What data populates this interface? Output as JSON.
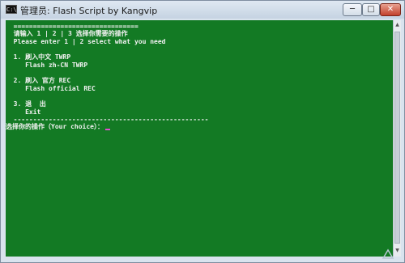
{
  "window": {
    "icon_text": "C:\\",
    "title": "管理员: Flash Script by Kangvip",
    "controls": {
      "minimize": "─",
      "maximize": "□",
      "close": "✕"
    }
  },
  "console": {
    "separator_top": "  ================================",
    "prompt_cn": "  请输入 1 | 2 | 3 选择你需要的操作",
    "prompt_en": "  Please enter 1 | 2 select what you need",
    "option1_cn": "  1. 刷入中文 TWRP",
    "option1_en": "     Flash zh-CN TWRP",
    "option2_cn": "  2. 刷入 官方 REC",
    "option2_en": "     Flash official REC",
    "option3_cn": "  3. 退  出",
    "option3_en": "     Exit",
    "separator_bottom": "  --------------------------------------------------",
    "input_prompt": "选择你的操作（Your choice）：",
    "accent_color": "#137a24"
  },
  "icons": [
    "app-icon",
    "minimize-icon",
    "maximize-icon",
    "close-icon",
    "scroll-up-icon",
    "scroll-down-icon"
  ]
}
